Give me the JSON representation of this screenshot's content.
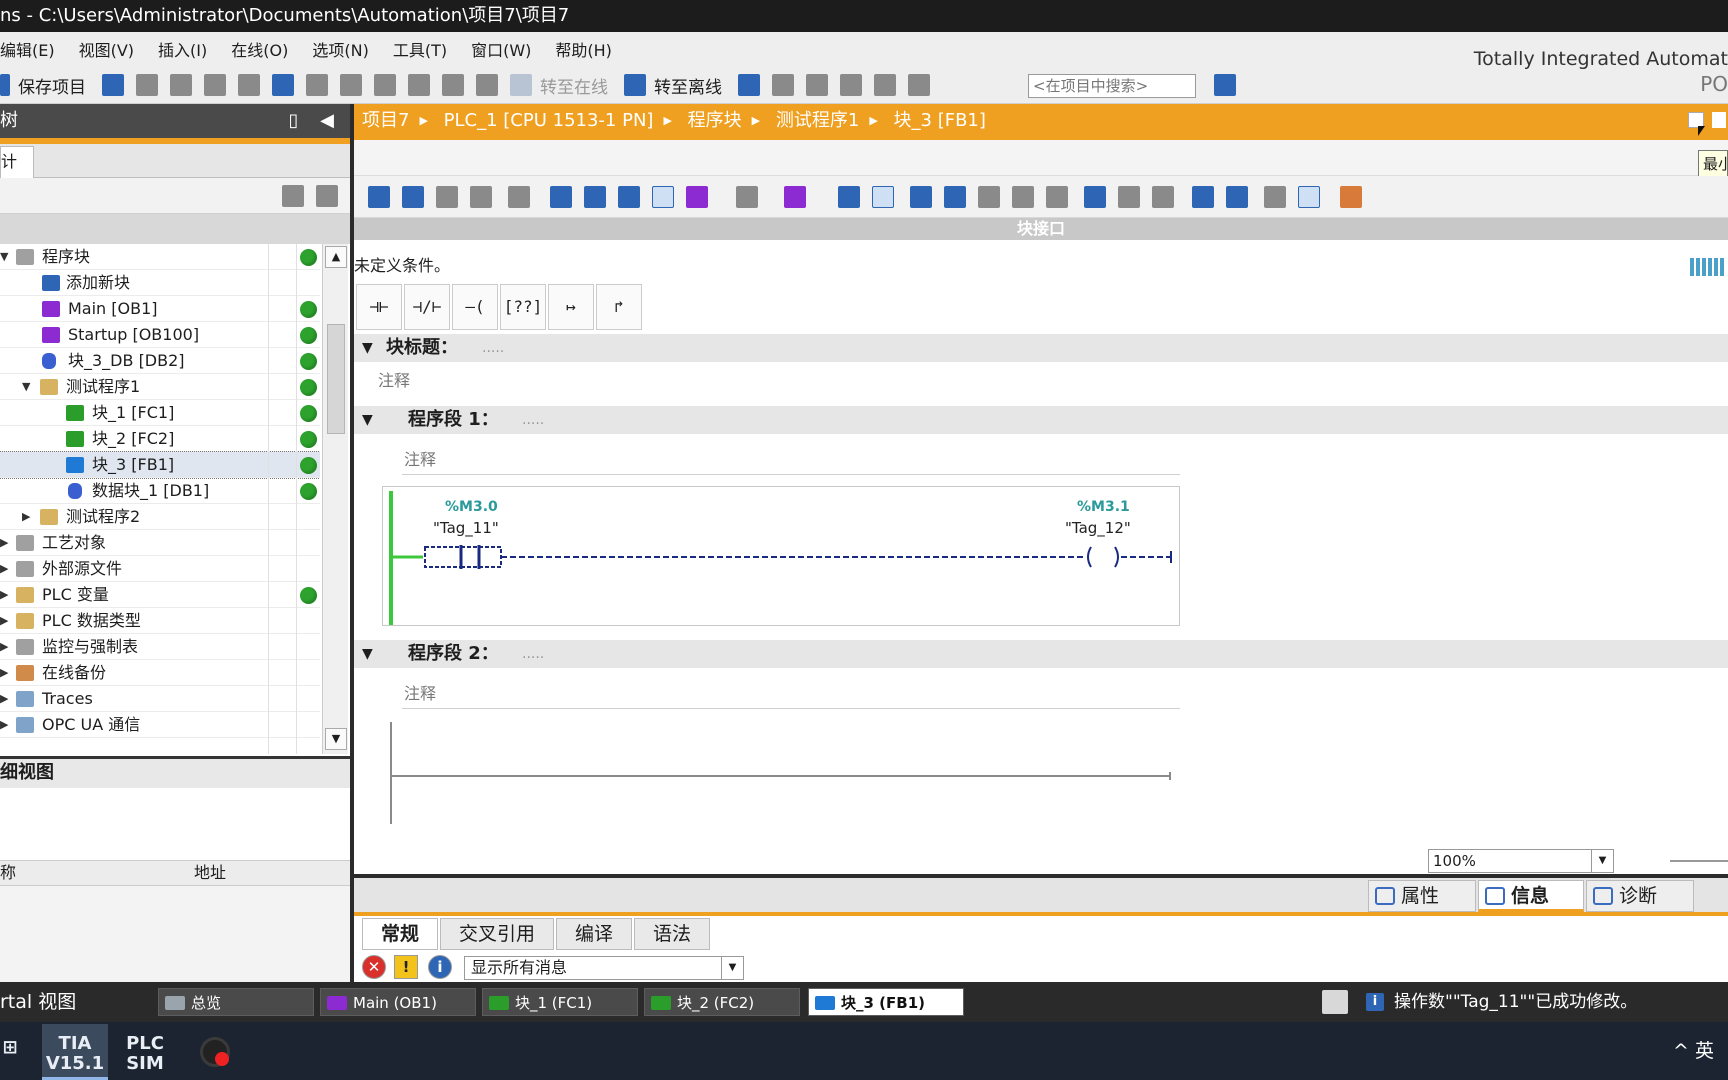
{
  "window": {
    "title": "ns  -  C:\\Users\\Administrator\\Documents\\Automation\\项目7\\项目7"
  },
  "menu": {
    "items": [
      "编辑(E)",
      "视图(V)",
      "插入(I)",
      "在线(O)",
      "选项(N)",
      "工具(T)",
      "窗口(W)",
      "帮助(H)"
    ],
    "brand": "Totally Integrated Automat",
    "brand2": "PO"
  },
  "toolbar": {
    "save_project": "保存项目",
    "go_online": "转至在线",
    "go_offline": "转至离线",
    "search_placeholder": "<在项目中搜索>"
  },
  "project_tree": {
    "header": "树",
    "tab": "计",
    "items": [
      {
        "label": "程序块",
        "expanded": true,
        "status": true
      },
      {
        "label": "添加新块",
        "status": false
      },
      {
        "label": "Main [OB1]",
        "status": true
      },
      {
        "label": "Startup [OB100]",
        "status": true
      },
      {
        "label": "块_3_DB [DB2]",
        "status": true
      },
      {
        "label": "测试程序1",
        "expanded": true,
        "status": true
      },
      {
        "label": "块_1 [FC1]",
        "status": true
      },
      {
        "label": "块_2 [FC2]",
        "status": true
      },
      {
        "label": "块_3 [FB1]",
        "status": true,
        "selected": true
      },
      {
        "label": "数据块_1 [DB1]",
        "status": true
      },
      {
        "label": "测试程序2",
        "status": false
      },
      {
        "label": "工艺对象",
        "status": false
      },
      {
        "label": "外部源文件",
        "status": false
      },
      {
        "label": "PLC 变量",
        "status": true
      },
      {
        "label": "PLC 数据类型",
        "status": false
      },
      {
        "label": "监控与强制表",
        "status": false
      },
      {
        "label": "在线备份",
        "status": false
      },
      {
        "label": "Traces",
        "status": false
      },
      {
        "label": "OPC UA 通信",
        "status": false
      }
    ]
  },
  "details_view": {
    "header": "细视图",
    "col_name": "称",
    "col_address": "地址"
  },
  "editor": {
    "breadcrumb": [
      "项目7",
      "PLC_1 [CPU 1513-1 PN]",
      "程序块",
      "测试程序1",
      "块_3 [FB1]"
    ],
    "block_interface": "块接口",
    "condition_text": "未定义条件。",
    "block_title_label": "块标题：",
    "block_title_value": ".....",
    "block_comment": "注释",
    "lad_palette": [
      "⊣⊢",
      "⊣/⊢",
      "–( )–",
      "[??]",
      "↦",
      "↱"
    ],
    "network1": {
      "title": "程序段 1：",
      "dots": ".....",
      "comment": "注释",
      "contact_address": "%M3.0",
      "contact_tag": "\"Tag_11\"",
      "coil_address": "%M3.1",
      "coil_tag": "\"Tag_12\""
    },
    "network2": {
      "title": "程序段 2：",
      "dots": ".....",
      "comment": "注释"
    },
    "zoom": "100%",
    "tooltip": "最小"
  },
  "inspector": {
    "tabs": [
      "属性",
      "信息",
      "诊断"
    ],
    "active_tab": "信息",
    "subtabs": [
      "常规",
      "交叉引用",
      "编译",
      "语法"
    ],
    "active_subtab": "常规",
    "filter": "显示所有消息"
  },
  "portal_bar": {
    "portal_view": "rtal 视图",
    "tabs": [
      "总览",
      "Main (OB1)",
      "块_1 (FC1)",
      "块_2 (FC2)",
      "块_3 (FB1)"
    ],
    "active_tab": "块_3 (FB1)",
    "status_message": "操作数\"\"Tag_11\"\"已成功修改。"
  },
  "taskbar": {
    "apps": [
      {
        "label": "TIA\nV15.1"
      },
      {
        "label": "PLC\nSIM"
      }
    ],
    "tray_text": "^  英"
  }
}
